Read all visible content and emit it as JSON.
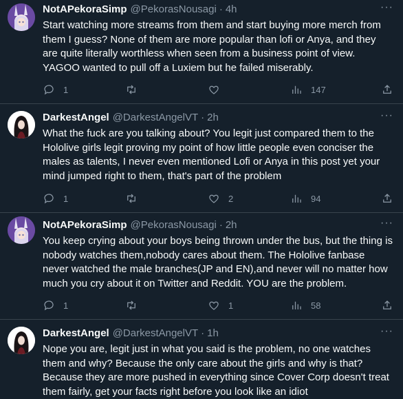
{
  "tweets": [
    {
      "avatar": "bunny-eared-anime-avatar",
      "name": "NotAPekoraSimp",
      "handle": "@PekorasNousagi",
      "time": "4h",
      "text": "Start watching more streams from them and start buying more merch from them I guess? None of them are more popular than lofi or Anya, and they are quite literally worthless when seen from a business point of view. YAGOO wanted to pull off a Luxiem but he failed miserably.",
      "replies": "1",
      "retweets": "",
      "likes": "",
      "views": "147"
    },
    {
      "avatar": "dark-haired-anime-avatar",
      "name": "DarkestAngel",
      "handle": "@DarkestAngelVT",
      "time": "2h",
      "text": "What the fuck are you talking about? You legit just compared them to the Hololive girls legit proving my point of how little people even conciser the males as talents, I never even mentioned Lofi or Anya in this post yet your mind jumped right to them, that's part of the problem",
      "replies": "1",
      "retweets": "",
      "likes": "2",
      "views": "94"
    },
    {
      "avatar": "bunny-eared-anime-avatar",
      "name": "NotAPekoraSimp",
      "handle": "@PekorasNousagi",
      "time": "2h",
      "text": "You keep crying about your boys being thrown under the bus, but the thing is nobody watches them,nobody cares about them. The Hololive fanbase never watched the male branches(JP and EN),and never will no matter how much you cry about it on Twitter and Reddit. YOU are the problem.",
      "replies": "1",
      "retweets": "",
      "likes": "1",
      "views": "58"
    },
    {
      "avatar": "dark-haired-anime-avatar",
      "name": "DarkestAngel",
      "handle": "@DarkestAngelVT",
      "time": "1h",
      "text": "Nope you are, legit just in what you said is the problem, no one watches them and why? Because the only care about the girls and why is that? Because they are more pushed in everything since Cover Corp doesn't treat them fairly, get your facts right before you look like an idiot"
    }
  ],
  "separator": "·",
  "more_glyph": "···",
  "colors": {
    "background": "#15202b",
    "text": "#f7f9f9",
    "muted": "#8b98a5",
    "border": "#38444d"
  }
}
